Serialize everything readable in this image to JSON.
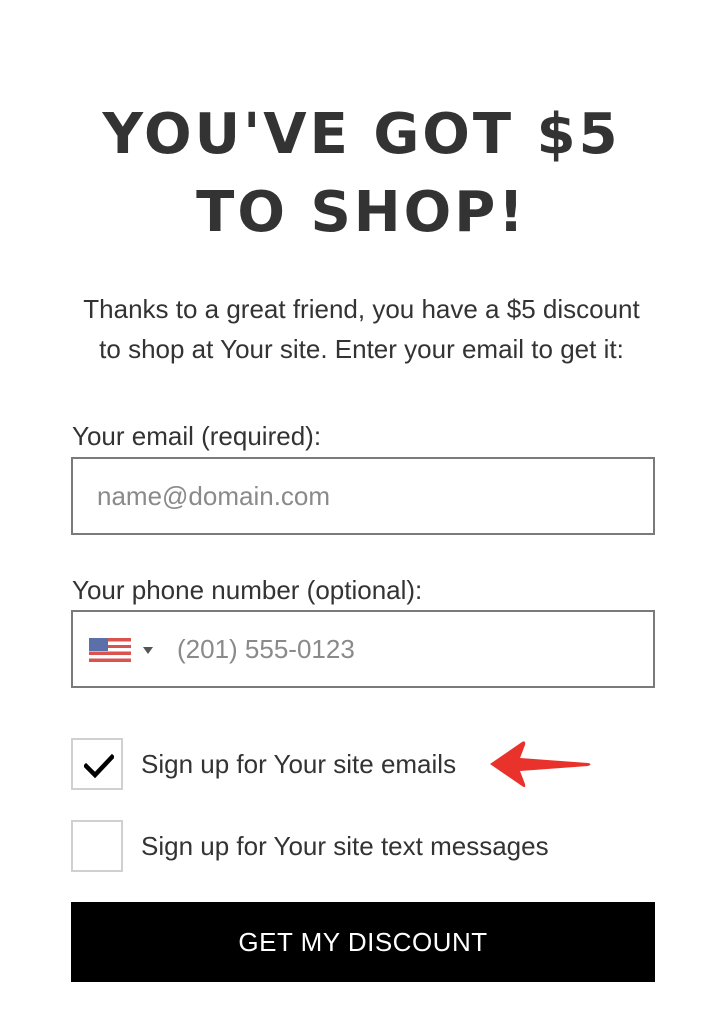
{
  "headline": {
    "line1": "YOU'VE GOT $5",
    "line2": "TO SHOP!"
  },
  "intro": {
    "line1": "Thanks to a great friend, you have a $5 discount",
    "line2": "to shop at Your site. Enter your email to get it:"
  },
  "email": {
    "label": "Your email (required):",
    "placeholder": "name@domain.com",
    "value": ""
  },
  "phone": {
    "label": "Your phone number (optional):",
    "placeholder": "(201) 555-0123",
    "value": "",
    "country_flag_icon": "us-flag-icon"
  },
  "checkboxes": [
    {
      "label": "Sign up for Your site emails",
      "checked": true
    },
    {
      "label": "Sign up for Your site text messages",
      "checked": false
    }
  ],
  "annotation": {
    "arrow_icon": "red-arrow-icon",
    "arrow_color": "#e8322b"
  },
  "submit": {
    "label": "GET MY DISCOUNT",
    "background": "#000000",
    "color": "#ffffff"
  }
}
